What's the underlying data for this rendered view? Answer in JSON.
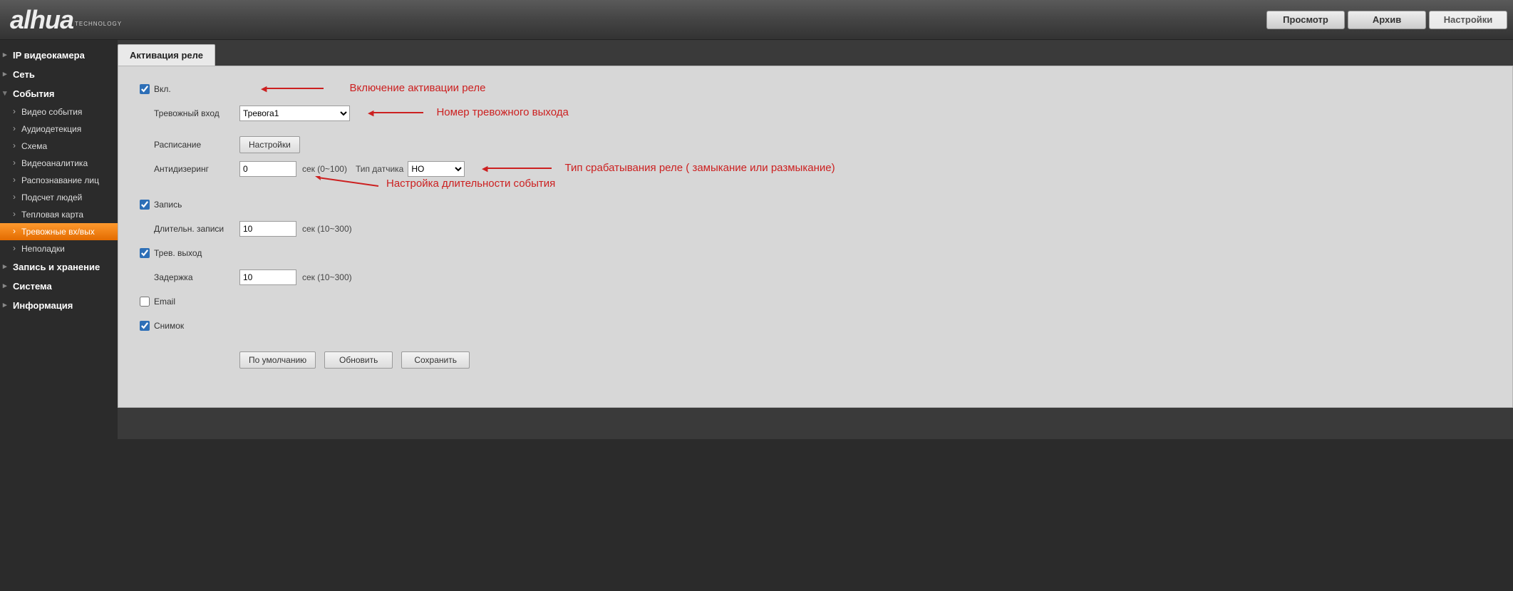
{
  "brand": {
    "logo": "alhua",
    "sub": "TECHNOLOGY"
  },
  "topnav": {
    "preview": "Просмотр",
    "archive": "Архив",
    "settings": "Настройки"
  },
  "sidebar": {
    "ipcam": "IP видеокамера",
    "network": "Сеть",
    "events": "События",
    "events_items": {
      "video": "Видео события",
      "audio": "Аудиодетекция",
      "scheme": "Схема",
      "analytics": "Видеоаналитика",
      "face": "Распознавание лиц",
      "people": "Подсчет людей",
      "heatmap": "Тепловая карта",
      "alarmio": "Тревожные вх/вых",
      "faults": "Неполадки"
    },
    "storage": "Запись и хранение",
    "system": "Система",
    "info": "Информация"
  },
  "tab": {
    "title": "Активация реле"
  },
  "form": {
    "enable": "Вкл.",
    "alarm_in_label": "Тревожный вход",
    "alarm_in_value": "Тревога1",
    "schedule_label": "Расписание",
    "schedule_btn": "Настройки",
    "antidither_label": "Антидизеринг",
    "antidither_value": "0",
    "antidither_unit": "сек (0~100)",
    "sensor_label": "Тип датчика",
    "sensor_value": "НО",
    "record": "Запись",
    "record_dur_label": "Длительн. записи",
    "record_dur_value": "10",
    "record_dur_unit": "сек (10~300)",
    "alarm_out": "Трев. выход",
    "delay_label": "Задержка",
    "delay_value": "10",
    "delay_unit": "сек (10~300)",
    "email": "Email",
    "snapshot": "Снимок",
    "btn_default": "По умолчанию",
    "btn_refresh": "Обновить",
    "btn_save": "Сохранить"
  },
  "annot": {
    "enable": "Включение активации реле",
    "alarm_in": "Номер тревожного выхода",
    "sensor": "Тип срабатывания реле ( замыкание или размыкание)",
    "antidither": "Настройка длительности события"
  }
}
